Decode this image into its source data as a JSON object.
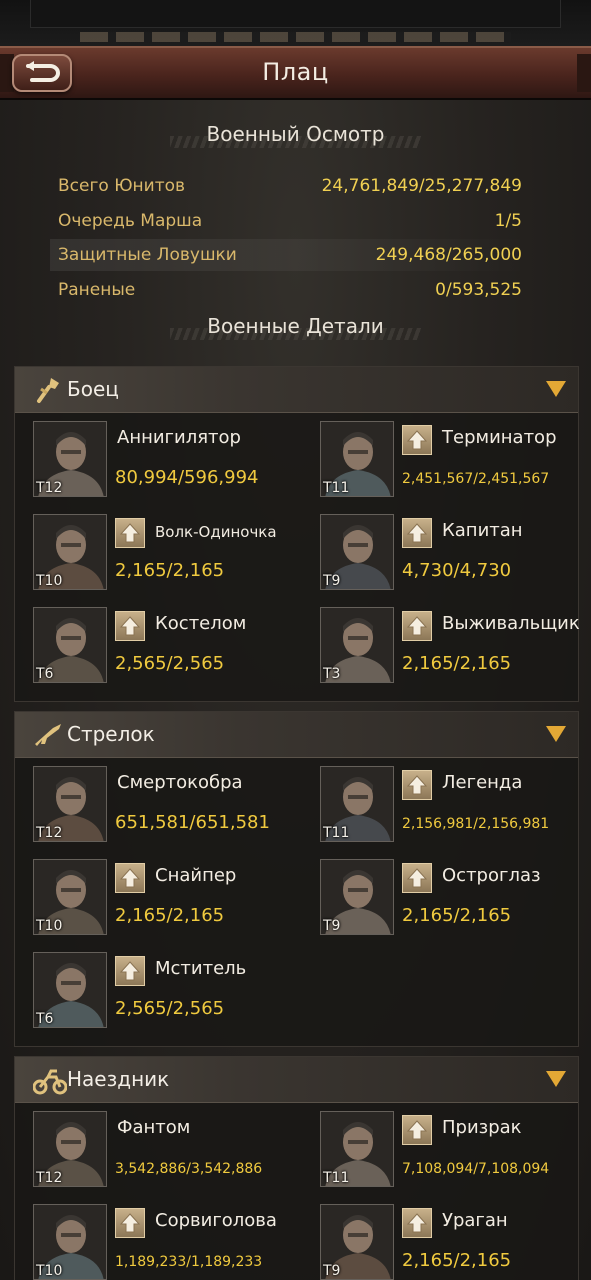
{
  "header": {
    "title": "Плац",
    "back_icon": "back-arrow-icon"
  },
  "inspection": {
    "title": "Военный Осмотр",
    "rows": [
      {
        "label": "Всего Юнитов",
        "value": "24,761,849/25,277,849"
      },
      {
        "label": "Очередь Марша",
        "value": "1/5"
      },
      {
        "label": "Защитные Ловушки",
        "value": "249,468/265,000"
      },
      {
        "label": "Раненые",
        "value": "0/593,525"
      }
    ]
  },
  "details": {
    "title": "Военные Детали"
  },
  "categories": [
    {
      "label": "Боец",
      "icon": "fist-icon",
      "units": [
        {
          "name": "Аннигилятор",
          "tier": "T12",
          "count": "80,994/596,994",
          "upgrade": false
        },
        {
          "name": "Терминатор",
          "tier": "T11",
          "count": "2,451,567/2,451,567",
          "upgrade": true
        },
        {
          "name": "Волк-Одиночка",
          "tier": "T10",
          "count": "2,165/2,165",
          "upgrade": true
        },
        {
          "name": "Капитан",
          "tier": "T9",
          "count": "4,730/4,730",
          "upgrade": true
        },
        {
          "name": "Костелом",
          "tier": "T6",
          "count": "2,565/2,565",
          "upgrade": true
        },
        {
          "name": "Выживальщик",
          "tier": "T3",
          "count": "2,165/2,165",
          "upgrade": true
        }
      ]
    },
    {
      "label": "Стрелок",
      "icon": "rifle-icon",
      "units": [
        {
          "name": "Смертокобра",
          "tier": "T12",
          "count": "651,581/651,581",
          "upgrade": false
        },
        {
          "name": "Легенда",
          "tier": "T11",
          "count": "2,156,981/2,156,981",
          "upgrade": true
        },
        {
          "name": "Снайпер",
          "tier": "T10",
          "count": "2,165/2,165",
          "upgrade": true
        },
        {
          "name": "Остроглаз",
          "tier": "T9",
          "count": "2,165/2,165",
          "upgrade": true
        },
        {
          "name": "Мститель",
          "tier": "T6",
          "count": "2,565/2,565",
          "upgrade": true
        }
      ]
    },
    {
      "label": "Наездник",
      "icon": "motorcycle-icon",
      "units": [
        {
          "name": "Фантом",
          "tier": "T12",
          "count": "3,542,886/3,542,886",
          "upgrade": false
        },
        {
          "name": "Призрак",
          "tier": "T11",
          "count": "7,108,094/7,108,094",
          "upgrade": true
        },
        {
          "name": "Сорвиголова",
          "tier": "T10",
          "count": "1,189,233/1,189,233",
          "upgrade": true
        },
        {
          "name": "Ураган",
          "tier": "T9",
          "count": "2,165/2,165",
          "upgrade": true
        }
      ]
    }
  ],
  "colors": {
    "accent": "#e3a835",
    "count": "#f0ca3f",
    "label": "#d9b86b"
  }
}
